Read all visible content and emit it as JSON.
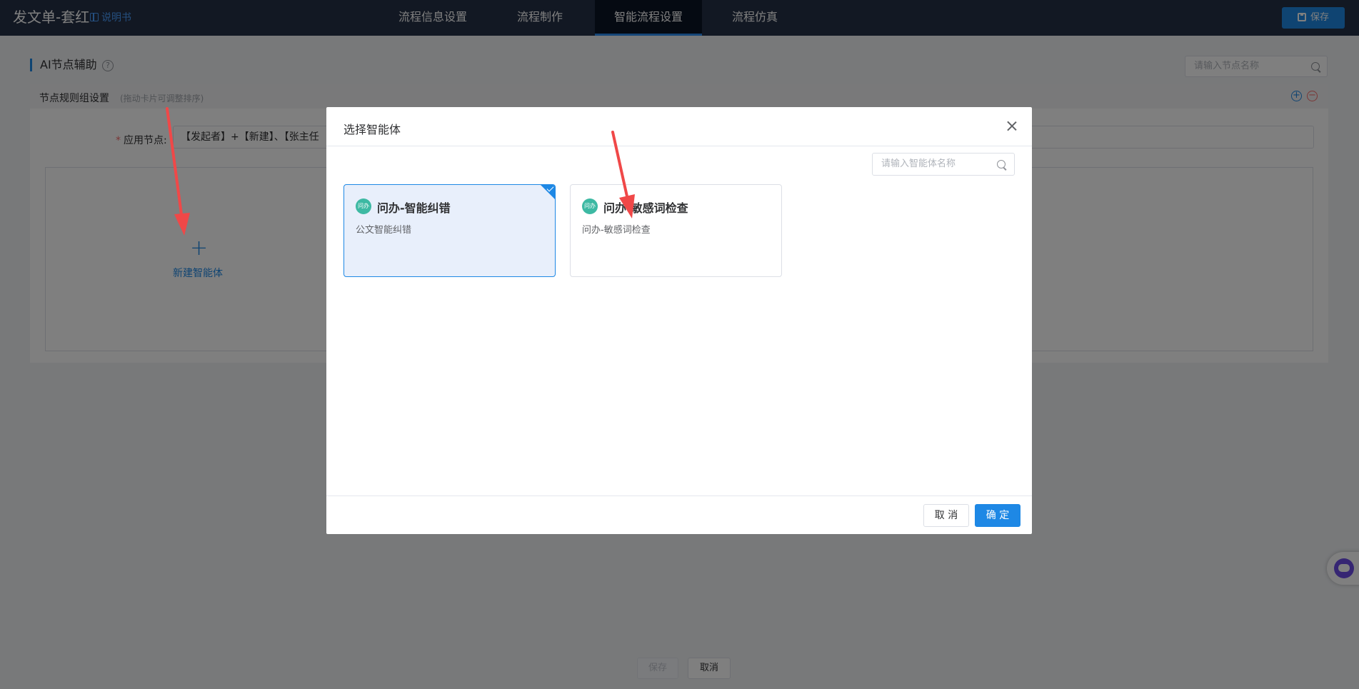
{
  "app": {
    "title": "发文单-套红",
    "manual_link": "说明书",
    "save_label": "保存"
  },
  "nav": {
    "tabs": [
      {
        "label": "流程信息设置",
        "active": false
      },
      {
        "label": "流程制作",
        "active": false
      },
      {
        "label": "智能流程设置",
        "active": true
      },
      {
        "label": "流程仿真",
        "active": false
      }
    ]
  },
  "section": {
    "title": "AI节点辅助",
    "help": "?",
    "search_placeholder": "请输入节点名称"
  },
  "panel": {
    "title": "节点规则组设置",
    "hint": "(拖动卡片可调整排序)",
    "add_symbol": "+",
    "remove_symbol": "−",
    "apply_required": "*",
    "apply_label": "应用节点:",
    "apply_value": "【发起者】+【新建】、【张主任",
    "new_symbol": "+",
    "new_agent_label": "新建智能体"
  },
  "footer": {
    "save_label": "保存",
    "cancel_label": "取消"
  },
  "modal": {
    "title": "选择智能体",
    "search_placeholder": "请输入智能体名称",
    "agents": [
      {
        "avatar": "问办",
        "name": "问办-智能纠错",
        "desc": "公文智能纠错",
        "selected": true
      },
      {
        "avatar": "问办",
        "name": "问办-敏感词检查",
        "desc": "问办-敏感词检查",
        "selected": false
      }
    ],
    "cancel_label": "取 消",
    "ok_label": "确 定"
  },
  "colors": {
    "primary": "#1e88e5",
    "topbar": "#253046",
    "arrow": "#f04848",
    "avatar": "#3db9a3"
  }
}
